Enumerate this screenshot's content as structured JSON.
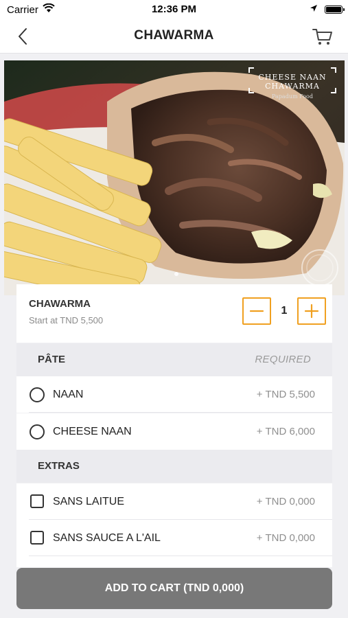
{
  "status_bar": {
    "carrier": "Carrier",
    "time": "12:36 PM"
  },
  "nav": {
    "title": "CHAWARMA",
    "back_icon": "chevron-left-icon",
    "cart_icon": "cart-icon"
  },
  "hero": {
    "watermark_title": "CHEESE NAAN CHAWARMA",
    "watermark_subtitle": "Papadum Food"
  },
  "product": {
    "name": "CHAWARMA",
    "price_text": "Start at TND 5,500",
    "quantity": "1"
  },
  "sections": [
    {
      "title": "PÂTE",
      "tag": "REQUIRED",
      "options": [
        {
          "label": "NAAN",
          "price": "+ TND 5,500",
          "type": "radio"
        },
        {
          "label": "CHEESE NAAN",
          "price": "+ TND 6,000",
          "type": "radio"
        }
      ]
    },
    {
      "title": "EXTRAS",
      "tag": "",
      "options": [
        {
          "label": "SANS LAITUE",
          "price": "+ TND 0,000",
          "type": "checkbox"
        },
        {
          "label": "SANS SAUCE A L'AIL",
          "price": "+ TND 0,000",
          "type": "checkbox"
        }
      ]
    }
  ],
  "add_to_cart": {
    "label": "ADD TO CART (TND 0,000)"
  },
  "colors": {
    "accent": "#f0a020",
    "button_disabled": "#787878",
    "section_bg": "#ebebef",
    "page_bg": "#f0f0f3"
  }
}
